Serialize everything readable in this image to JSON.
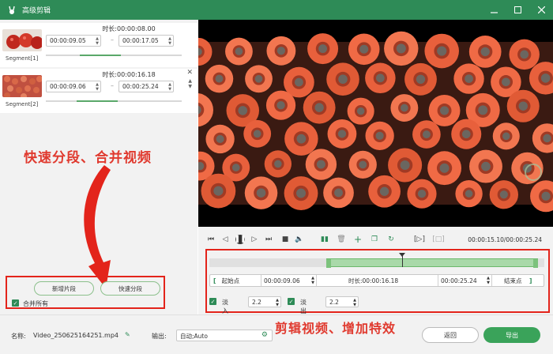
{
  "titlebar": {
    "title": "高级剪辑",
    "logo_icon": "rabbit-icon",
    "min_icon": "minimize-icon",
    "max_icon": "maximize-icon",
    "close_icon": "close-icon"
  },
  "segments": [
    {
      "label": "Segment[1]",
      "duration_label": "时长:",
      "duration": "00:00:08.00",
      "start": "00:00:09.05",
      "end": "00:00:17.05",
      "progress": 0.42
    },
    {
      "label": "Segment[2]",
      "duration_label": "时长:",
      "duration": "00:00:16.18",
      "start": "00:00:09.06",
      "end": "00:00:25.24",
      "progress": 0.38
    }
  ],
  "annotations": {
    "left": "快速分段、合并视频",
    "right": "剪辑视频、增加特效"
  },
  "left_actions": {
    "add_segment": "新增片段",
    "quick_split": "快速分段",
    "merge_all": "合并所有",
    "merge_checked": true
  },
  "player": {
    "time": "00:00:15.10/00:00:25.24"
  },
  "timeline": {
    "selection_start": 0.35,
    "selection_end": 0.98,
    "playhead": 0.575
  },
  "range": {
    "start_btn": "起始点",
    "start_value": "00:00:09.06",
    "duration_label": "时长:",
    "duration_value": "00:00:16.18",
    "end_value": "00:00:25.24",
    "end_btn": "结束点"
  },
  "fade": {
    "fade_in_label": "淡入",
    "fade_in_value": "2.2",
    "fade_out_label": "淡出",
    "fade_out_value": "2.2",
    "fade_in_checked": true,
    "fade_out_checked": true
  },
  "bottom": {
    "name_label": "名称:",
    "name_value": "Video_250625164251.mp4",
    "output_label": "输出:",
    "output_value": "自动;Auto",
    "back_btn": "返回",
    "export_btn": "导出"
  },
  "colors": {
    "accent": "#2e8b57",
    "annotation": "#e03a2f",
    "highlight_border": "#e3241b"
  }
}
